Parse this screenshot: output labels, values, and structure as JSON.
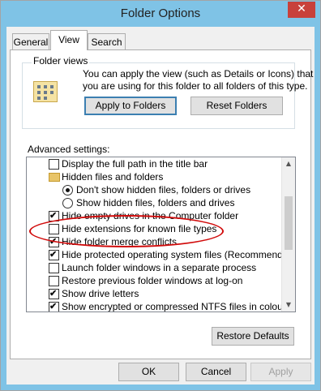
{
  "window": {
    "title": "Folder Options",
    "close_glyph": "✕"
  },
  "tabs": [
    {
      "label": "General"
    },
    {
      "label": "View"
    },
    {
      "label": "Search"
    }
  ],
  "folder_views": {
    "legend": "Folder views",
    "description_line1": "You can apply the view (such as Details or Icons) that",
    "description_line2": "you are using for this folder to all folders of this type.",
    "apply_button": "Apply to Folders",
    "reset_button": "Reset Folders"
  },
  "advanced": {
    "legend": "Advanced settings:",
    "items": [
      {
        "type": "checkbox",
        "checked": false,
        "label": "Display the full path in the title bar",
        "level": 1
      },
      {
        "type": "folder",
        "label": "Hidden files and folders",
        "level": 1
      },
      {
        "type": "radio",
        "checked": true,
        "label": "Don't show hidden files, folders or drives",
        "level": 2
      },
      {
        "type": "radio",
        "checked": false,
        "label": "Show hidden files, folders and drives",
        "level": 2
      },
      {
        "type": "checkbox",
        "checked": true,
        "label": "Hide empty drives in the Computer folder",
        "level": 1
      },
      {
        "type": "checkbox",
        "checked": false,
        "label": "Hide extensions for known file types",
        "level": 1
      },
      {
        "type": "checkbox",
        "checked": true,
        "label": "Hide folder merge conflicts",
        "level": 1
      },
      {
        "type": "checkbox",
        "checked": true,
        "label": "Hide protected operating system files (Recommended)",
        "level": 1
      },
      {
        "type": "checkbox",
        "checked": false,
        "label": "Launch folder windows in a separate process",
        "level": 1
      },
      {
        "type": "checkbox",
        "checked": false,
        "label": "Restore previous folder windows at log-on",
        "level": 1
      },
      {
        "type": "checkbox",
        "checked": true,
        "label": "Show drive letters",
        "level": 1
      },
      {
        "type": "checkbox",
        "checked": true,
        "label": "Show encrypted or compressed NTFS files in colour",
        "level": 1
      }
    ],
    "restore_button": "Restore Defaults"
  },
  "footer": {
    "ok": "OK",
    "cancel": "Cancel",
    "apply": "Apply"
  },
  "annotation": {
    "highlighted_item": "Hide extensions for known file types",
    "color": "#d10b0b"
  }
}
